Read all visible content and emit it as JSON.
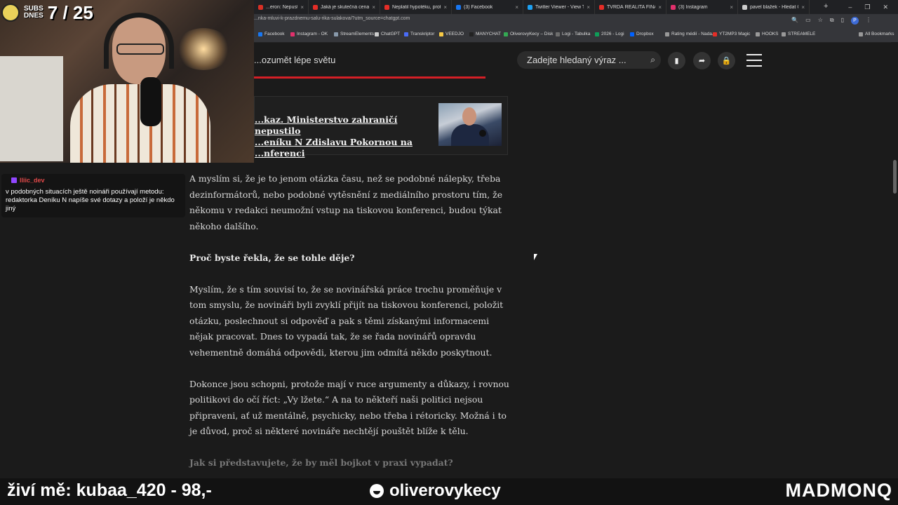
{
  "browser": {
    "tabs": [
      {
        "title": "...eron: Nepustit novin",
        "color": "#d93025"
      },
      {
        "title": "Jaká je skutečná cena nal",
        "color": "#e52d27"
      },
      {
        "title": "Neplatil hypotéku, protož",
        "color": "#e52d27"
      },
      {
        "title": "(3) Facebook",
        "color": "#1877f2"
      },
      {
        "title": "Twitter Viewer - View Twit",
        "color": "#1da1f2"
      },
      {
        "title": "TVRDÁ REALITA FINANČ",
        "color": "#e52d27"
      },
      {
        "title": "(3) Instagram",
        "color": "#e1306c"
      },
      {
        "title": "pavel blažek - Hledat Goo",
        "color": "#cccccc"
      }
    ],
    "new_tab": "+",
    "window_controls": {
      "minimize": "–",
      "maximize": "❐",
      "close": "✕"
    },
    "url": "...nka-mluvi-k-prazdnemu-salu-rika-sulakova/?utm_source=chatgpt.com",
    "profile_initial": "P",
    "bookmarks": [
      {
        "label": "Facebook",
        "color": "#1877f2"
      },
      {
        "label": "Instagram - OK",
        "color": "#e1306c"
      },
      {
        "label": "StreamElements",
        "color": "#8899aa"
      },
      {
        "label": "ChatGPT",
        "color": "#cccccc"
      },
      {
        "label": "Transkriptor",
        "color": "#4a6cf7"
      },
      {
        "label": "VEEDJO",
        "color": "#f6c945"
      },
      {
        "label": "MANYCHAT",
        "color": "#222222"
      },
      {
        "label": "OliverovyKecy – Disk",
        "color": "#34a853"
      },
      {
        "label": "Logi - Tabulka",
        "color": "#6d6d6d"
      },
      {
        "label": "2026 - Logi",
        "color": "#0f9d58"
      },
      {
        "label": "Dropbox",
        "color": "#0061ff"
      },
      {
        "label": "Rating médií - Nada...",
        "color": "#999999"
      },
      {
        "label": "YT2MP3 Magic",
        "color": "#e52d27"
      },
      {
        "label": "HOOKS",
        "color": "#999999"
      },
      {
        "label": "STREAMELE",
        "color": "#999999"
      },
      {
        "label": "All Bookmarks",
        "color": "#999999"
      }
    ]
  },
  "site": {
    "tagline": "...ozumět lépe světu",
    "search_placeholder": "Zadejte hledaný výraz ..."
  },
  "related": {
    "line1": "...kaz. Ministerstvo zahraničí nepustilo",
    "line2": "...eníku N Zdislavu Pokornou na",
    "line3": "...nferenci"
  },
  "article": {
    "p1": "A myslím si, že je to jenom otázka času, než se podobné nálepky, třeba dezinformátorů, nebo podobné vytěsnění z mediálního prostoru tím, že někomu v redakci neumožní vstup na tiskovou konferenci, budou týkat někoho dalšího.",
    "q1": "Proč byste řekla, že se tohle děje?",
    "p2": "Myslím, že s tím souvisí to, že se novinářská práce trochu proměňuje v tom smyslu, že novináři byli zvyklí přijít na tiskovou konferenci, položit otázku, poslechnout si odpověď a pak s těmi získanými informacemi nějak pracovat. Dnes to vypadá tak, že se řada novinářů opravdu vehementně domáhá odpovědi, kterou jim odmítá někdo poskytnout.",
    "p3": "Dokonce jsou schopni, protože mají v ruce argumenty a důkazy, i rovnou politikovi do očí říct: „Vy lžete.“ A na to někteří naši politici nejsou připraveni, ať už mentálně, psychicky, nebo třeba i rétoricky. Možná i to je důvod, proč si některé novináře nechtějí pouštět blíže k tělu.",
    "q2": "Jak si představujete, že by měl bojkot v praxi vypadat?"
  },
  "overlay": {
    "subs_label_1": "SUBS",
    "subs_label_2": "DNES",
    "subs_count": "7 / 25",
    "chat_user": "lliic_dev",
    "chat_message": "v podobných situacích ještě noináři používají metodu: redaktorka Deníku N napíše své dotazy a položí je někdo jiný",
    "footer_left": "živí mě: kubaa_420 - 98,-",
    "footer_mid": "oliverovykecy",
    "footer_right": "MADMONQ"
  },
  "icons": {
    "search": "search-icon",
    "bookmark": "bookmark-icon",
    "share": "share-icon",
    "lock": "lock-icon",
    "menu": "hamburger-menu-icon"
  },
  "colors": {
    "accent_red": "#d41f26",
    "background": "#1b1b1b"
  }
}
